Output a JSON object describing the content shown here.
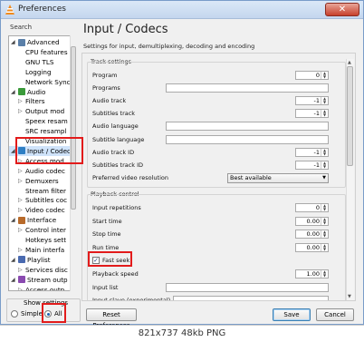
{
  "window": {
    "title": "Preferences",
    "close_symbol": "✕"
  },
  "sidebar": {
    "search_label": "Search",
    "search_placeholder": "",
    "items": [
      {
        "label": "Advanced",
        "level": 0,
        "expander": "◢",
        "icon": "gear-icon",
        "icon_color": "#5a7fa8"
      },
      {
        "label": "CPU features",
        "level": 1
      },
      {
        "label": "GNU TLS",
        "level": 1
      },
      {
        "label": "Logging",
        "level": 1
      },
      {
        "label": "Network Sync",
        "level": 1
      },
      {
        "label": "Audio",
        "level": 0,
        "expander": "◢",
        "icon": "audio-icon",
        "icon_color": "#3a9a3a"
      },
      {
        "label": "Filters",
        "level": 1,
        "expander": "▷"
      },
      {
        "label": "Output mod",
        "level": 1,
        "expander": "▷"
      },
      {
        "label": "Speex resam",
        "level": 1
      },
      {
        "label": "SRC resampl",
        "level": 1
      },
      {
        "label": "Visualization",
        "level": 1
      },
      {
        "label": "Input / Codec",
        "level": 0,
        "expander": "◢",
        "icon": "codec-icon",
        "icon_color": "#2f7fc4",
        "selected": true
      },
      {
        "label": "Access mod",
        "level": 1,
        "expander": "▷"
      },
      {
        "label": "Audio codec",
        "level": 1,
        "expander": "▷"
      },
      {
        "label": "Demuxers",
        "level": 1,
        "expander": "▷"
      },
      {
        "label": "Stream filter",
        "level": 1
      },
      {
        "label": "Subtitles coc",
        "level": 1,
        "expander": "▷"
      },
      {
        "label": "Video codec",
        "level": 1,
        "expander": "▷"
      },
      {
        "label": "Interface",
        "level": 0,
        "expander": "◢",
        "icon": "interface-icon",
        "icon_color": "#b86a2a"
      },
      {
        "label": "Control inter",
        "level": 1,
        "expander": "▷"
      },
      {
        "label": "Hotkeys sett",
        "level": 1
      },
      {
        "label": "Main interfa",
        "level": 1,
        "expander": "▷"
      },
      {
        "label": "Playlist",
        "level": 0,
        "expander": "◢",
        "icon": "playlist-icon",
        "icon_color": "#4a6ab0"
      },
      {
        "label": "Services disc",
        "level": 1,
        "expander": "▷"
      },
      {
        "label": "Stream outp",
        "level": 0,
        "expander": "◢",
        "icon": "stream-icon",
        "icon_color": "#8a4ab0"
      },
      {
        "label": "Access outp",
        "level": 1,
        "expander": "▷"
      }
    ],
    "show_settings": {
      "label": "Show settings",
      "options": [
        {
          "label": "Simple",
          "checked": false
        },
        {
          "label": "All",
          "checked": true
        }
      ]
    }
  },
  "panel": {
    "title": "Input / Codecs",
    "subtitle": "Settings for input, demultiplexing, decoding and encoding",
    "track_settings": {
      "title": "Track settings",
      "rows": [
        {
          "label": "Program",
          "kind": "spin",
          "value": "0"
        },
        {
          "label": "Programs",
          "kind": "text",
          "value": ""
        },
        {
          "label": "Audio track",
          "kind": "spin",
          "value": "-1"
        },
        {
          "label": "Subtitles track",
          "kind": "spin",
          "value": "-1"
        },
        {
          "label": "Audio language",
          "kind": "text",
          "value": ""
        },
        {
          "label": "Subtitle language",
          "kind": "text",
          "value": ""
        },
        {
          "label": "Audio track ID",
          "kind": "spin",
          "value": "-1"
        },
        {
          "label": "Subtitles track ID",
          "kind": "spin",
          "value": "-1"
        },
        {
          "label": "Preferred video resolution",
          "kind": "combo",
          "value": "Best available"
        }
      ]
    },
    "playback_control": {
      "title": "Playback control",
      "rows": [
        {
          "label": "Input repetitions",
          "kind": "spin",
          "value": "0"
        },
        {
          "label": "Start time",
          "kind": "spin",
          "value": "0.00"
        },
        {
          "label": "Stop time",
          "kind": "spin",
          "value": "0.00"
        },
        {
          "label": "Run time",
          "kind": "spin",
          "value": "0.00"
        },
        {
          "label": "Fast seek",
          "kind": "check",
          "checked": true
        },
        {
          "label": "Playback speed",
          "kind": "spin",
          "value": "1.00"
        },
        {
          "label": "Input list",
          "kind": "text",
          "value": ""
        },
        {
          "label": "Input slave (experimental)",
          "kind": "text",
          "value": ""
        }
      ]
    }
  },
  "buttons": {
    "reset": "Reset Preferences",
    "save": "Save",
    "cancel": "Cancel"
  },
  "footer": "821x737 48kb PNG"
}
